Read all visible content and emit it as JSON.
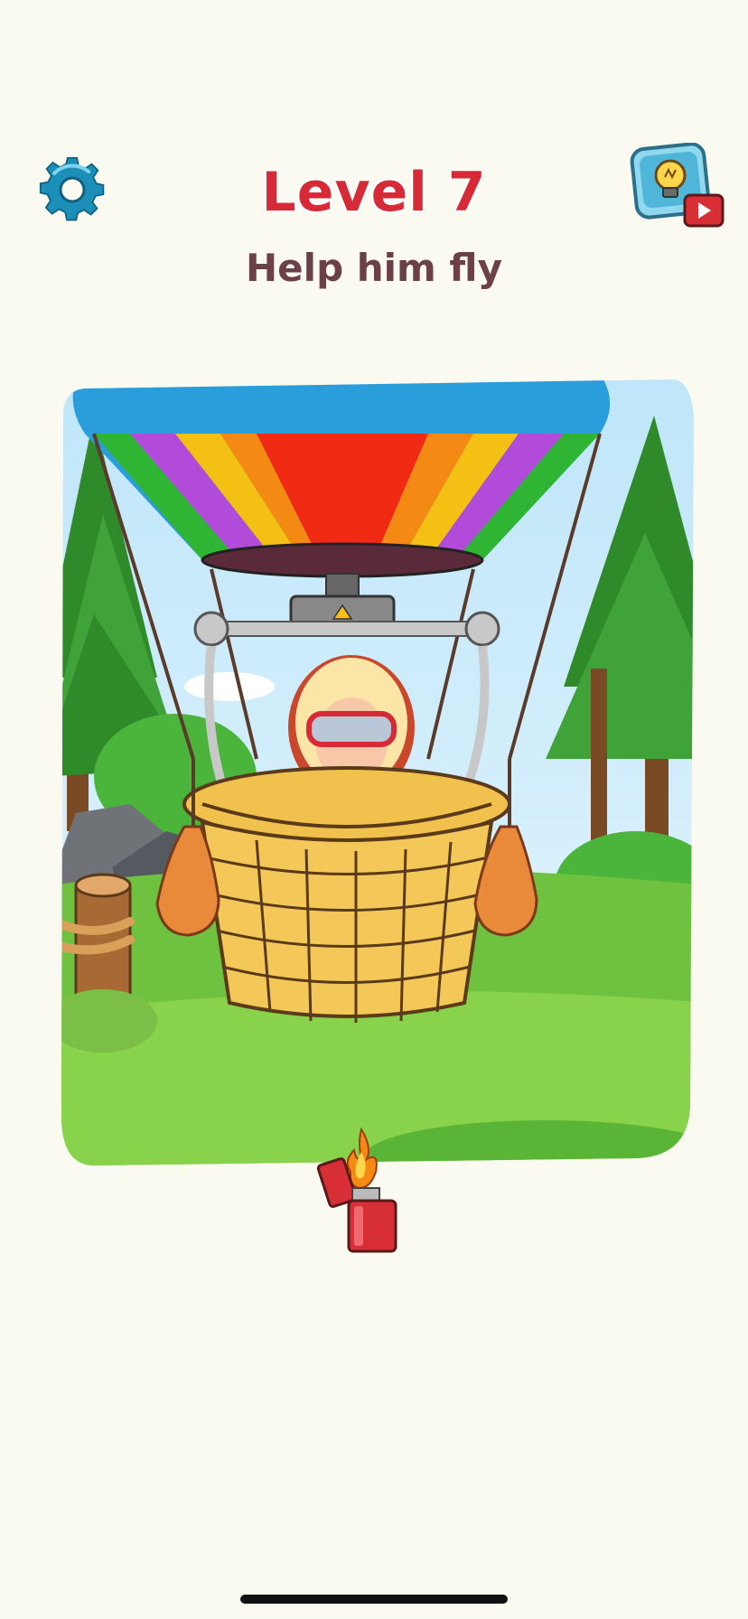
{
  "header": {
    "level_title": "Level 7",
    "subtitle": "Help him fly"
  },
  "buttons": {
    "settings_icon": "gear-icon",
    "hint_icon": "lightbulb-icon",
    "hint_video_icon": "play-video-icon"
  },
  "scene": {
    "objects": [
      "hot-air-balloon",
      "basket",
      "boy-with-goggles",
      "sandbag-left",
      "sandbag-right",
      "burner",
      "tree-stump",
      "trees",
      "rocks",
      "bushes"
    ]
  },
  "tool": {
    "name": "lighter",
    "icon": "lighter-icon"
  },
  "colors": {
    "background": "#fbfaf0",
    "title_red": "#d62b36",
    "subtitle_brown": "#6b4047",
    "gear_teal": "#1b8fb8"
  }
}
